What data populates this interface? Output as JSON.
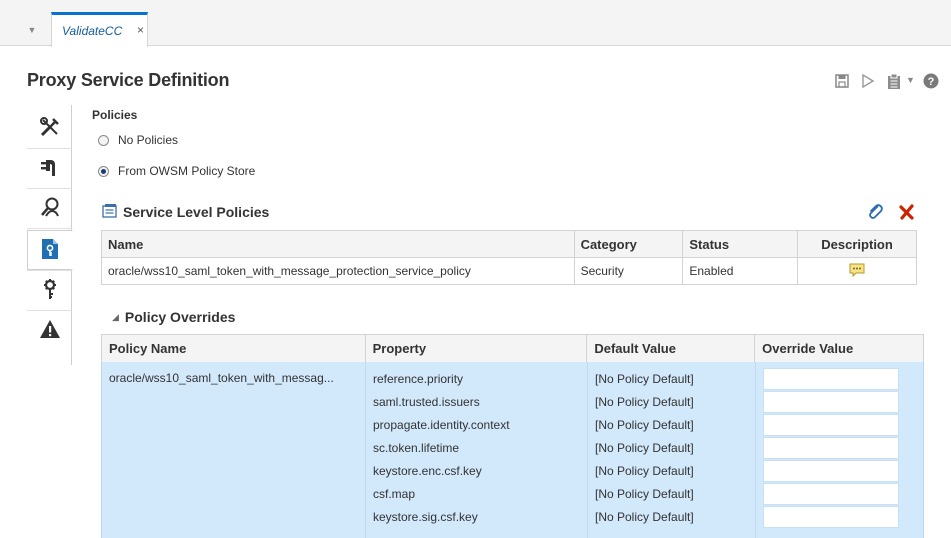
{
  "tabs": [
    {
      "label": "ValidateCC",
      "close": "×"
    }
  ],
  "header": {
    "title": "Proxy Service Definition"
  },
  "policies": {
    "heading": "Policies",
    "options": [
      {
        "label": "No Policies",
        "checked": false
      },
      {
        "label": "From OWSM Policy Store",
        "checked": true
      }
    ]
  },
  "service_level": {
    "title": "Service Level Policies",
    "columns": [
      "Name",
      "Category",
      "Status",
      "Description"
    ],
    "rows": [
      {
        "name": "oracle/wss10_saml_token_with_message_protection_service_policy",
        "category": "Security",
        "status": "Enabled"
      }
    ]
  },
  "overrides": {
    "title": "Policy Overrides",
    "columns": [
      "Policy Name",
      "Property",
      "Default Value",
      "Override Value"
    ],
    "policy_name": "oracle/wss10_saml_token_with_messag...",
    "rows": [
      {
        "property": "reference.priority",
        "default": "[No Policy Default]",
        "override": ""
      },
      {
        "property": "saml.trusted.issuers",
        "default": "[No Policy Default]",
        "override": ""
      },
      {
        "property": "propagate.identity.context",
        "default": "[No Policy Default]",
        "override": ""
      },
      {
        "property": "sc.token.lifetime",
        "default": "[No Policy Default]",
        "override": ""
      },
      {
        "property": "keystore.enc.csf.key",
        "default": "[No Policy Default]",
        "override": ""
      },
      {
        "property": "csf.map",
        "default": "[No Policy Default]",
        "override": ""
      },
      {
        "property": "keystore.sig.csf.key",
        "default": "[No Policy Default]",
        "override": ""
      }
    ]
  },
  "colors": {
    "accent": "#0572ce",
    "selected_row": "#d2e8fb",
    "delete": "#cc2200"
  }
}
